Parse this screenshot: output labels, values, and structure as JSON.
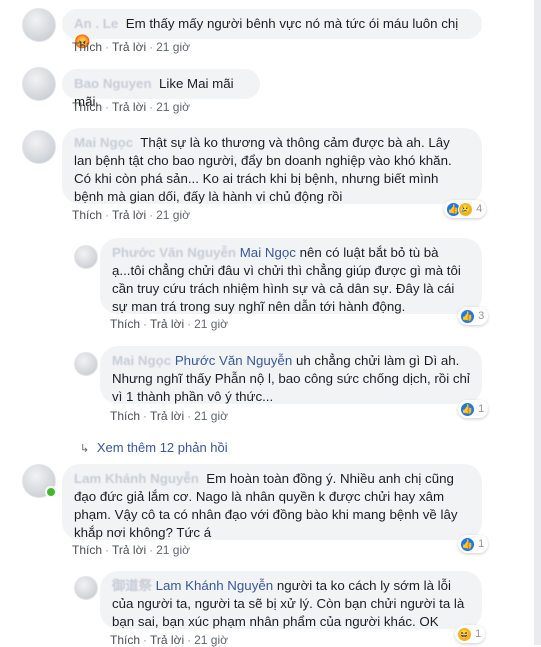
{
  "comments": [
    {
      "name": "An . Le",
      "text": "Em thấy mấy người bênh vực nó mà tức ói máu luôn chị 😡",
      "like": "Thích",
      "reply": "Trả lời",
      "time": "21 giờ"
    },
    {
      "name": "Bao Nguyen",
      "text": "Like Mai mãi mãi.",
      "like": "Thích",
      "reply": "Trả lời",
      "time": "21 giờ"
    },
    {
      "name": "Mai Ngọc",
      "text": "Thật sự là ko thương và thông cảm được bà ah. Lây lan bệnh tật cho bao người, đẩy bn doanh nghiệp vào khó khăn. Có khi còn phá sản... Ko ai trách khi bị bệnh, nhưng biết mình bệnh mà gian dối, đấy là hành vi chủ động rồi",
      "like": "Thích",
      "reply": "Trả lời",
      "time": "21 giờ",
      "reactions": "4"
    },
    {
      "name": "Phước Văn Nguyễn",
      "mention": "Mai Ngọc",
      "text": "nên có luật bắt bỏ tù bà ạ...tôi chẳng chửi đâu vì chửi thì chẳng giúp được gì mà tôi cần truy cứu trách nhiệm hình sự và cả dân sự. Đây là cái sự man trá trong suy nghĩ nên dẫn tới hành động.",
      "like": "Thích",
      "reply": "Trả lời",
      "time": "21 giờ",
      "reactions": "3"
    },
    {
      "name": "Mai Ngọc",
      "mention": "Phước Văn Nguyễn",
      "text": "uh chẳng chửi làm gì Dì ah. Nhưng nghĩ thấy Phẫn nộ l, bao công sức chống dịch, rồi chỉ vì 1 thành phần vô ý thức...",
      "like": "Thích",
      "reply": "Trả lời",
      "time": "21 giờ",
      "reactions": "1"
    },
    {
      "name": "Lam Khánh Nguyễn",
      "text": "Em hoàn toàn đồng ý. Nhiều anh chị cũng đạo đức giả lắm cơ. Nago là nhân quyền k được chửi hay xâm phạm. Vậy cô ta có nhân đạo với đồng bào khi mang bệnh về lây khắp nơi không? Tức á",
      "like": "Thích",
      "reply": "Trả lời",
      "time": "21 giờ",
      "reactions": "1"
    },
    {
      "name": "御道祭",
      "mention": "Lam Khánh Nguyễn",
      "text": "người ta ko cách ly sớm là lỗi của người ta, người ta sẽ bị xử lý. Còn bạn chửi người ta là bạn sai, bạn xúc phạm nhân phẩm của người khác. OK",
      "like": "Thích",
      "reply": "Trả lời",
      "time": "21 giờ",
      "reactions": "1"
    }
  ],
  "see_more": "Xem thêm 12 phản hồi",
  "icons": {
    "like": "like-icon",
    "haha": "haha-icon",
    "sad": "sad-icon",
    "chevron": "reply-arrow-icon"
  },
  "colors": {
    "link": "#385898",
    "bubble": "#f2f3f5",
    "meta": "#606770"
  }
}
